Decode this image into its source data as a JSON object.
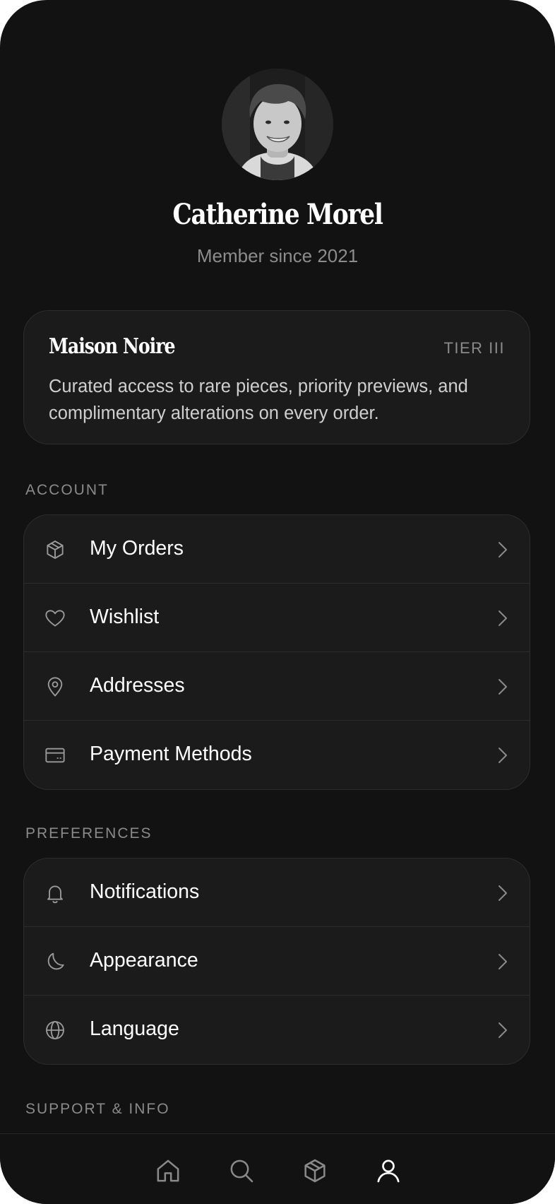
{
  "profile": {
    "name": "Catherine Morel",
    "member_since": "Member since 2021"
  },
  "membership": {
    "brand": "Maison Noire",
    "tier": "TIER III",
    "description": "Curated access to rare pieces, priority previews, and complimentary alterations on every order."
  },
  "sections": {
    "account": {
      "label": "ACCOUNT",
      "items": [
        {
          "label": "My Orders",
          "icon": "box-icon"
        },
        {
          "label": "Wishlist",
          "icon": "heart-icon"
        },
        {
          "label": "Addresses",
          "icon": "location-pin-icon"
        },
        {
          "label": "Payment Methods",
          "icon": "credit-card-icon"
        }
      ]
    },
    "preferences": {
      "label": "PREFERENCES",
      "items": [
        {
          "label": "Notifications",
          "icon": "bell-icon"
        },
        {
          "label": "Appearance",
          "icon": "moon-icon"
        },
        {
          "label": "Language",
          "icon": "globe-icon"
        }
      ]
    },
    "support": {
      "label": "SUPPORT & INFO"
    }
  },
  "tabbar": {
    "items": [
      {
        "icon": "home-icon",
        "active": false
      },
      {
        "icon": "search-icon",
        "active": false
      },
      {
        "icon": "box-icon",
        "active": false
      },
      {
        "icon": "user-icon",
        "active": true
      }
    ]
  },
  "colors": {
    "background": "#121212",
    "card": "#1b1b1b",
    "border": "#2c2c2c",
    "text_primary": "#ffffff",
    "text_muted": "#8a8a8a"
  }
}
